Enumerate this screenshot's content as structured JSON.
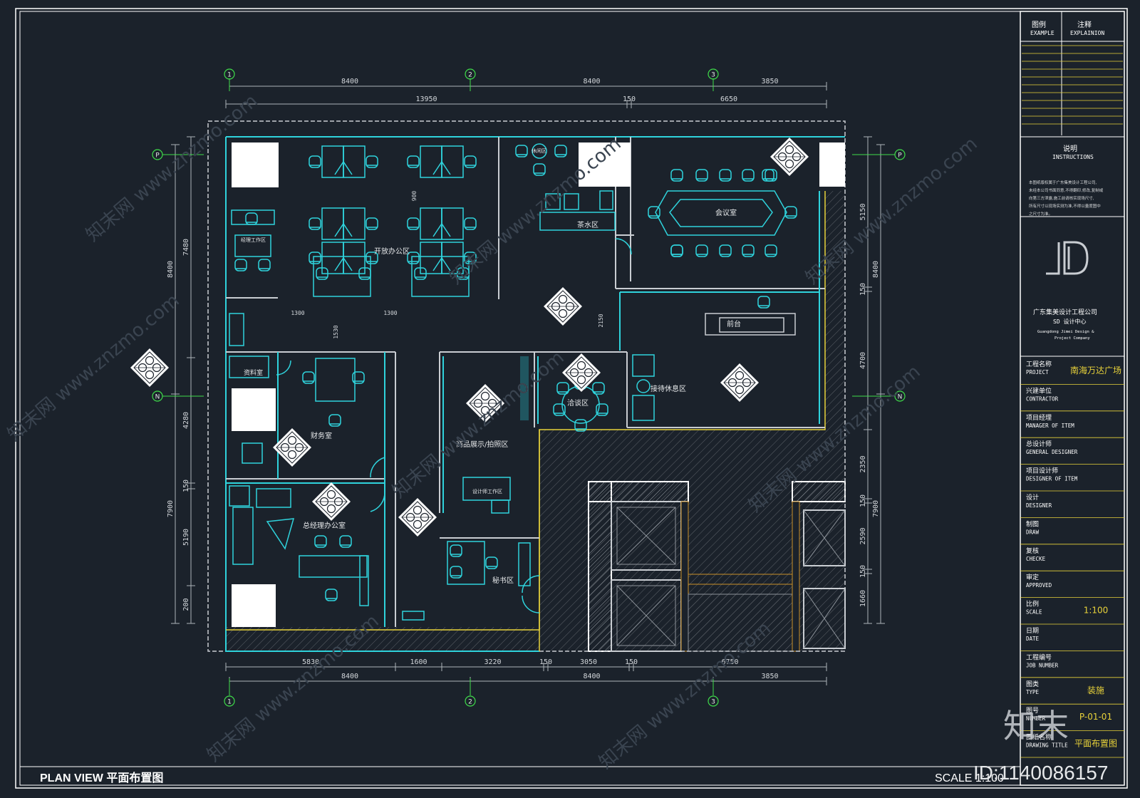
{
  "drawing": {
    "title": "PLAN VIEW  平面布置图",
    "scale_label": "SCALE 1:100",
    "watermark_id": "ID:1140086157",
    "watermark_logo": "知末",
    "watermark_text": "知末网 www.znzmo.com"
  },
  "axes": {
    "vertical": [
      "1",
      "2",
      "3"
    ],
    "horizontal": [
      "P",
      "N"
    ]
  },
  "dimensions": {
    "top_row1": [
      "8400",
      "8400",
      "3850"
    ],
    "top_row2": [
      "13950",
      "150",
      "6650"
    ],
    "bottom_row1": [
      "5830",
      "1600",
      "3220",
      "150",
      "3050",
      "150",
      "6750"
    ],
    "bottom_row2": [
      "8400",
      "8400",
      "3850"
    ],
    "left_outer": [
      "8400",
      "7900"
    ],
    "left_inner": [
      "7480",
      "4280",
      "150",
      "5190",
      "200"
    ],
    "right_outer": [
      "8400",
      "7900"
    ],
    "right_inner": [
      "5150",
      "150",
      "4700",
      "2350",
      "150",
      "2590",
      "150",
      "1660"
    ],
    "interior": [
      "900",
      "1300",
      "1300",
      "1530",
      "2150"
    ]
  },
  "rooms": {
    "open_office": "开放办公区",
    "manager_workroom": "经理工作区",
    "tea_area": "茶水区",
    "rest_area": "休闲区",
    "meeting_room": "会议室",
    "reception": "前台",
    "waiting_lounge": "接待休息区",
    "archive": "资料室",
    "finance": "财务室",
    "product_display": "商品展示/拍照区",
    "design_workroom": "设计师工作区",
    "negotiation": "洽谈区",
    "gm_office": "总经理办公室",
    "secretary": "秘书区"
  },
  "title_block": {
    "legend_cn": "图例",
    "legend_en": "EXAMPLE",
    "notes_cn": "注释",
    "notes_en": "EXPLAINION",
    "instructions_cn": "说明",
    "instructions_en": "INSTRUCTIONS",
    "instruction_lines": [
      "本图纸版权属于广东集美设计工程公司,",
      "未经本公司书面同意,不得翻印,修改,复制或",
      "向第三方泄露,施工前请核实现场尺寸,",
      "所有尺寸以现场实测为准,不得以量度图中",
      "之尺寸为准。"
    ],
    "company_cn": "广东集美设计工程公司",
    "company_center": "SD 设计中心",
    "company_en1": "Guangdong Jimei Design &",
    "company_en2": "Project Company",
    "rows": [
      {
        "cn": "工程名称",
        "en": "PROJECT",
        "value": "南海万达广场"
      },
      {
        "cn": "兴建单位",
        "en": "CONTRACTOR",
        "value": ""
      },
      {
        "cn": "项目经理",
        "en": "MANAGER OF ITEM",
        "value": ""
      },
      {
        "cn": "总设计师",
        "en": "GENERAL DESIGNER",
        "value": ""
      },
      {
        "cn": "项目设计师",
        "en": "DESIGNER OF ITEM",
        "value": ""
      },
      {
        "cn": "设计",
        "en": "DESIGNER",
        "value": ""
      },
      {
        "cn": "制图",
        "en": "DRAW",
        "value": ""
      },
      {
        "cn": "复核",
        "en": "CHECKE",
        "value": ""
      },
      {
        "cn": "审定",
        "en": "APPROVED",
        "value": ""
      },
      {
        "cn": "比例",
        "en": "SCALE",
        "value": "1:100"
      },
      {
        "cn": "日期",
        "en": "DATE",
        "value": ""
      },
      {
        "cn": "工程编号",
        "en": "JOB NUMBER",
        "value": ""
      },
      {
        "cn": "图类",
        "en": "TYPE",
        "value": "装施"
      },
      {
        "cn": "图号",
        "en": "NUMBER",
        "value": "P-01-01"
      },
      {
        "cn": "图纸名称",
        "en": "DRAWING TITLE",
        "value": "平面布置图"
      }
    ]
  },
  "colors": {
    "background": "#1b222b",
    "frame": "#ffffff",
    "furniture": "#2fd3dc",
    "wall": "#c9cdd2",
    "yellow": "#e8d23a",
    "dimension": "#aeb4ba",
    "green": "#3fdc4a",
    "orange": "#c8902a"
  }
}
